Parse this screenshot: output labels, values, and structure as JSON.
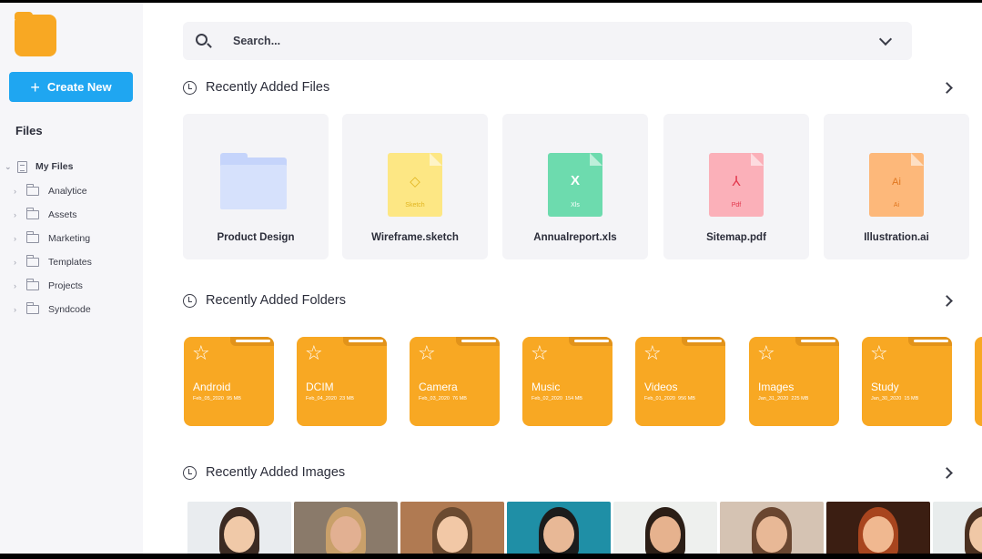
{
  "sidebar": {
    "create_label": "Create New",
    "files_heading": "Files",
    "root": "My Files",
    "items": [
      {
        "label": "Analytice"
      },
      {
        "label": "Assets"
      },
      {
        "label": "Marketing"
      },
      {
        "label": "Templates"
      },
      {
        "label": "Projects"
      },
      {
        "label": "Syndcode"
      }
    ]
  },
  "search": {
    "placeholder": "Search..."
  },
  "sections": {
    "files_title": "Recently Added Files",
    "folders_title": "Recently Added Folders",
    "images_title": "Recently Added Images"
  },
  "files": [
    {
      "name": "Product Design",
      "kind": "folder",
      "color": "#c5d4fb"
    },
    {
      "name": "Wireframe.sketch",
      "kind": "sketch",
      "ext": "Sketch",
      "mark": "◇",
      "color": "#fde784",
      "text_color": "#e1b520"
    },
    {
      "name": "Annualreport.xls",
      "kind": "xls",
      "ext": "Xls",
      "mark": "X",
      "color": "#6ddbae",
      "text_color": "#ffffff"
    },
    {
      "name": "Sitemap.pdf",
      "kind": "pdf",
      "ext": "Pdf",
      "mark": "⅄",
      "color": "#fbb0b9",
      "text_color": "#e2374c"
    },
    {
      "name": "Illustration.ai",
      "kind": "ai",
      "ext": "Ai",
      "mark": "Ai",
      "color": "#fdb87a",
      "text_color": "#e0761f"
    }
  ],
  "folders": [
    {
      "name": "Android",
      "date": "Feb_05_2020",
      "size": "95 MB"
    },
    {
      "name": "DCIM",
      "date": "Feb_04_2020",
      "size": "23 MB"
    },
    {
      "name": "Camera",
      "date": "Feb_03_2020",
      "size": "76 MB"
    },
    {
      "name": "Music",
      "date": "Feb_02_2020",
      "size": "154 MB"
    },
    {
      "name": "Videos",
      "date": "Feb_01_2020",
      "size": "956 MB"
    },
    {
      "name": "Images",
      "date": "Jan_31_2020",
      "size": "225 MB"
    },
    {
      "name": "Study",
      "date": "Jan_30_2020",
      "size": "15 MB"
    }
  ],
  "colors": {
    "accent": "#1fa6f1",
    "folder": "#f8a823",
    "surface": "#f4f4f7"
  },
  "images": [
    {
      "bg": "#e9ecef",
      "skin": "#f0c9a8",
      "hair": "#3b2a22"
    },
    {
      "bg": "#8a7a6a",
      "skin": "#e2b092",
      "hair": "#c9a06a"
    },
    {
      "bg": "#b07a52",
      "skin": "#f2c8a6",
      "hair": "#6b4a30"
    },
    {
      "bg": "#1f8fa6",
      "skin": "#e8b896",
      "hair": "#1c1c1c"
    },
    {
      "bg": "#eef0ee",
      "skin": "#e6b28e",
      "hair": "#2b1e16"
    },
    {
      "bg": "#d5c3b3",
      "skin": "#e8b896",
      "hair": "#6a4630"
    },
    {
      "bg": "#3b1e12",
      "skin": "#f0b890",
      "hair": "#a8451e"
    },
    {
      "bg": "#e8ecec",
      "skin": "#f0c8a6",
      "hair": "#4a3020"
    }
  ]
}
